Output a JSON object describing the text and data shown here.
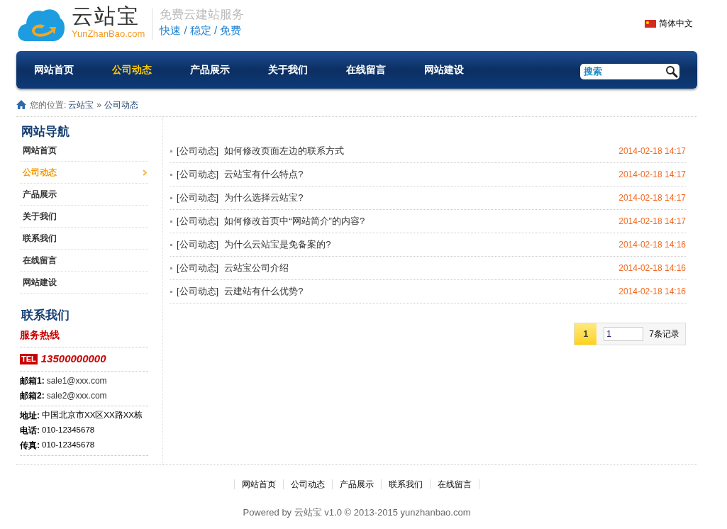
{
  "logo": {
    "name": "云站宝",
    "domain": "YunZhanBao.com"
  },
  "slogan": {
    "title": "免费云建站服务",
    "tagline": "快速 / 稳定 / 免费"
  },
  "language": {
    "label": "简体中文"
  },
  "nav": {
    "items": [
      {
        "label": "网站首页",
        "selected": false
      },
      {
        "label": "公司动态",
        "selected": true
      },
      {
        "label": "产品展示",
        "selected": false
      },
      {
        "label": "关于我们",
        "selected": false
      },
      {
        "label": "在线留言",
        "selected": false
      },
      {
        "label": "网站建设",
        "selected": false
      }
    ],
    "search": {
      "placeholder": "搜索"
    }
  },
  "breadcrumb": {
    "label": "您的位置:",
    "items": [
      "云站宝",
      "公司动态"
    ],
    "separator": "»"
  },
  "sidebar": {
    "title": "网站导航",
    "items": [
      {
        "label": "网站首页",
        "selected": false
      },
      {
        "label": "公司动态",
        "selected": true
      },
      {
        "label": "产品展示",
        "selected": false
      },
      {
        "label": "关于我们",
        "selected": false
      },
      {
        "label": "联系我们",
        "selected": false
      },
      {
        "label": "在线留言",
        "selected": false
      },
      {
        "label": "网站建设",
        "selected": false
      }
    ]
  },
  "contact": {
    "title": "联系我们",
    "hotline_title": "服务热线",
    "tel_badge": "TEL",
    "phone": "13500000000",
    "emails": [
      {
        "label": "邮箱1:",
        "value": "sale1@xxx.com"
      },
      {
        "label": "邮箱2:",
        "value": "sale2@xxx.com"
      }
    ],
    "details": [
      {
        "label": "地址:",
        "value": "中国北京市XX区XX路XX栋"
      },
      {
        "label": "电话:",
        "value": "010-12345678"
      },
      {
        "label": "传真:",
        "value": "010-12345678"
      }
    ]
  },
  "articles": [
    {
      "category": "[公司动态]",
      "title": "如何修改页面左边的联系方式",
      "date": "2014-02-18 14:17"
    },
    {
      "category": "[公司动态]",
      "title": "云站宝有什么特点?",
      "date": "2014-02-18 14:17"
    },
    {
      "category": "[公司动态]",
      "title": "为什么选择云站宝?",
      "date": "2014-02-18 14:17"
    },
    {
      "category": "[公司动态]",
      "title": "如何修改首页中“网站简介”的内容?",
      "date": "2014-02-18 14:17"
    },
    {
      "category": "[公司动态]",
      "title": "为什么云站宝是免备案的?",
      "date": "2014-02-18 14:16"
    },
    {
      "category": "[公司动态]",
      "title": "云站宝公司介绍",
      "date": "2014-02-18 14:16"
    },
    {
      "category": "[公司动态]",
      "title": "云建站有什么优势?",
      "date": "2014-02-18 14:16"
    }
  ],
  "pagination": {
    "pages": [
      {
        "label": "1",
        "selected": true
      }
    ],
    "page_input": "1",
    "total": "7条记录"
  },
  "footer": {
    "links": [
      "网站首页",
      "公司动态",
      "产品展示",
      "联系我们",
      "在线留言"
    ],
    "copyright": "Powered by 云站宝 v1.0 © 2013-2015 yunzhanbao.com"
  }
}
